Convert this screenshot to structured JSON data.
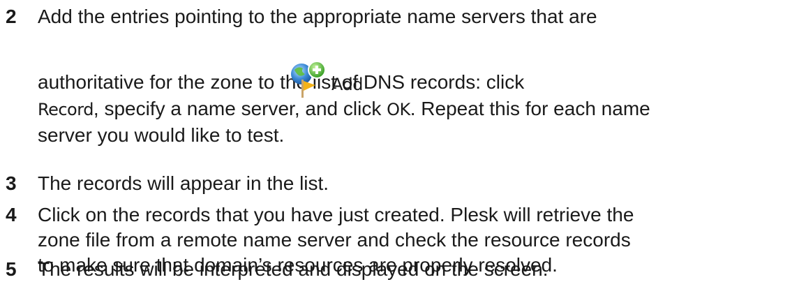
{
  "steps": [
    {
      "number": "2",
      "line1": "Add the entries pointing to the appropriate name servers that are",
      "line2_before": "authoritative for the zone to the list of DNS records: click",
      "add_record_label_part1": "Add",
      "add_record_label_part2": "Record",
      "line3_after": ", specify a name server, and click ",
      "ok_label": "OK",
      "line3_end": ". Repeat this for each name",
      "line4": "server you would like to test.",
      "icon": "add-record-icon"
    },
    {
      "number": "3",
      "lines": [
        "The records will appear in the list."
      ]
    },
    {
      "number": "4",
      "lines": [
        "Click on the records that you have just created. Plesk will retrieve the",
        "zone file from a remote name server and check the resource records",
        "to make sure that domain’s resources are properly resolved."
      ]
    },
    {
      "number": "5",
      "lines": [
        "The results will be interpreted and displayed on the screen."
      ]
    }
  ]
}
